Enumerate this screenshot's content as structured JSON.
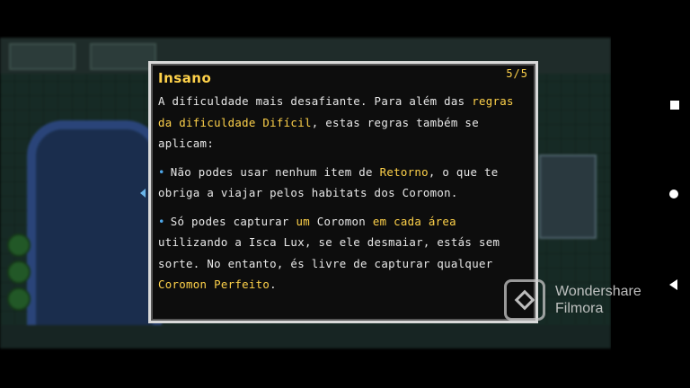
{
  "dialog": {
    "title": "Insano",
    "page": "5/5",
    "intro": [
      {
        "t": "A dificuldade mais desafiante. Para além das ",
        "h": false
      },
      {
        "t": "regras da dificuldade Difícil",
        "h": true
      },
      {
        "t": ", estas regras também se aplicam:",
        "h": false
      }
    ],
    "bullets": [
      [
        {
          "t": "Não podes usar nenhum item de ",
          "h": false
        },
        {
          "t": "Retorno",
          "h": true
        },
        {
          "t": ", o que te obriga a viajar pelos habitats dos Coromon.",
          "h": false
        }
      ],
      [
        {
          "t": "Só podes capturar ",
          "h": false
        },
        {
          "t": "um",
          "h": true
        },
        {
          "t": " Coromon ",
          "h": false
        },
        {
          "t": "em cada área",
          "h": true
        },
        {
          "t": " utilizando a Isca Lux, se ele desmaiar, estás sem sorte. No entanto, és livre de capturar qualquer ",
          "h": false
        },
        {
          "t": "Coromon Perfeito",
          "h": true
        },
        {
          "t": ".",
          "h": false
        }
      ]
    ]
  },
  "watermark": {
    "line1": "Wondershare",
    "line2": "Filmora",
    "logo_icon": "filmora-logo-icon"
  },
  "nav_bar": {
    "icons": [
      "recent-apps-icon",
      "home-icon",
      "back-icon"
    ]
  },
  "colors": {
    "highlight": "#ffd24a",
    "bullet": "#4fa8ea",
    "text": "#e8e8e8",
    "dialog_bg": "#0d0d0d",
    "border": "#d9d9d9"
  }
}
